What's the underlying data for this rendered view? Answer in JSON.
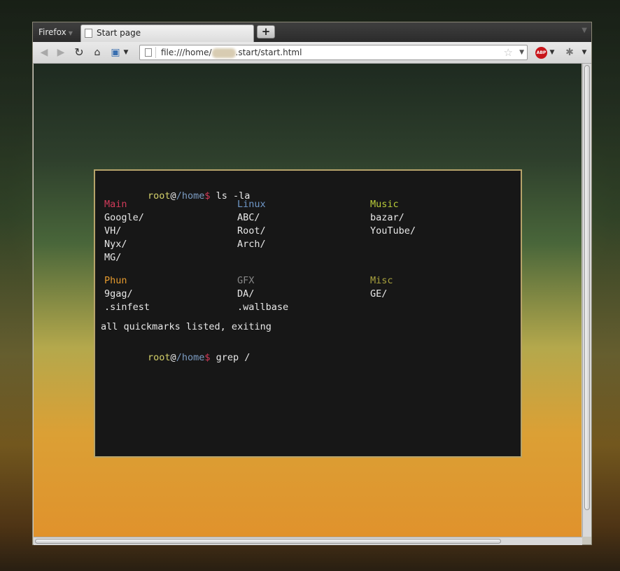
{
  "browser": {
    "menu_label": "Firefox",
    "tab_title": "Start page",
    "new_tab_symbol": "+",
    "url_prefix": "file:///home/",
    "url_suffix": ".start/start.html",
    "abp_label": "ABP"
  },
  "terminal": {
    "prompt_user": "root",
    "prompt_at": "@",
    "prompt_path": "/home",
    "prompt_dollar": "$",
    "command1": " ls -la",
    "command2": " grep /",
    "status": "all quickmarks listed, exiting",
    "groups": [
      {
        "title": "Main",
        "color": "#d13b5a",
        "items": [
          "Google/",
          "VH/",
          "Nyx/",
          "MG/"
        ]
      },
      {
        "title": "Linux",
        "color": "#6f98c9",
        "items": [
          "ABC/",
          "Root/",
          "Arch/"
        ]
      },
      {
        "title": "Music",
        "color": "#b9cc3a",
        "items": [
          "bazar/",
          "YouTube/"
        ]
      },
      {
        "title": "Phun",
        "color": "#e59a2e",
        "items": [
          "9gag/",
          ".sinfest"
        ]
      },
      {
        "title": "GFX",
        "color": "#888888",
        "items": [
          "DA/",
          ".wallbase"
        ]
      },
      {
        "title": "Misc",
        "color": "#a9a23e",
        "items": [
          "GE/"
        ]
      }
    ]
  },
  "icons": [
    "page-icon",
    "back-icon",
    "forward-icon",
    "reload-icon",
    "home-icon",
    "bookmark-icon",
    "star-icon",
    "abp-icon",
    "addon-icon"
  ]
}
